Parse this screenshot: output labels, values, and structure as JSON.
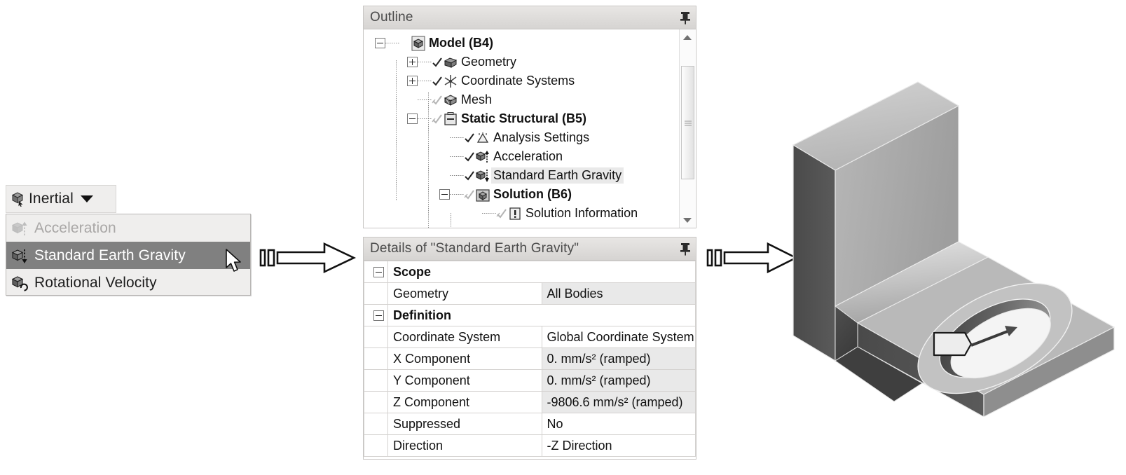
{
  "toolbar": {
    "inertial_button": {
      "label": "Inertial",
      "icon": "inertial-cube-icon",
      "caret": "chevron-down-icon"
    }
  },
  "inertial_menu": {
    "items": [
      {
        "label": "Acceleration",
        "icon": "cube-up-arrow-icon",
        "state": "disabled"
      },
      {
        "label": "Standard Earth Gravity",
        "icon": "cube-down-arrow-icon",
        "state": "selected"
      },
      {
        "label": "Rotational Velocity",
        "icon": "cube-rotation-icon",
        "state": "normal"
      }
    ]
  },
  "cursor": {
    "icon": "mouse-pointer-icon"
  },
  "flow": {
    "arrow_1": {
      "icon": "right-block-arrow-icon"
    },
    "arrow_2": {
      "icon": "right-block-arrow-icon"
    }
  },
  "outline_panel": {
    "title": "Outline",
    "pin_icon": "pin-icon",
    "scrollbar": {
      "up_icon": "scroll-up-arrow-icon",
      "down_icon": "scroll-down-arrow-icon",
      "grip_icon": "scroll-thumb-grip-icon"
    },
    "tree": [
      {
        "label": "Model (B4)",
        "indent": 0,
        "bold": true,
        "expander": "minus",
        "check": "none",
        "icon": "model-cube-icon",
        "highlight": false
      },
      {
        "label": "Geometry",
        "indent": 1,
        "bold": false,
        "expander": "plus",
        "check": "check",
        "icon": "geometry-icon",
        "highlight": false
      },
      {
        "label": "Coordinate Systems",
        "indent": 1,
        "bold": false,
        "expander": "plus",
        "check": "check",
        "icon": "coordinate-systems-icon",
        "highlight": false
      },
      {
        "label": "Mesh",
        "indent": 1,
        "bold": false,
        "expander": "none",
        "check": "partial",
        "icon": "mesh-icon",
        "highlight": false
      },
      {
        "label": "Static Structural (B5)",
        "indent": 1,
        "bold": true,
        "expander": "minus",
        "check": "partial",
        "icon": "static-structural-icon",
        "highlight": false
      },
      {
        "label": "Analysis Settings",
        "indent": 2,
        "bold": false,
        "expander": "none",
        "check": "check",
        "icon": "analysis-settings-icon",
        "highlight": false
      },
      {
        "label": "Acceleration",
        "indent": 2,
        "bold": false,
        "expander": "none",
        "check": "check",
        "icon": "cube-up-arrow-icon",
        "highlight": false
      },
      {
        "label": "Standard Earth Gravity",
        "indent": 2,
        "bold": false,
        "expander": "none",
        "check": "check",
        "icon": "cube-down-arrow-icon",
        "highlight": true
      },
      {
        "label": "Solution (B6)",
        "indent": 2,
        "bold": true,
        "expander": "minus",
        "check": "partial",
        "icon": "solution-icon",
        "highlight": false
      },
      {
        "label": "Solution Information",
        "indent": 3,
        "bold": false,
        "expander": "none",
        "check": "partial",
        "icon": "solution-information-icon",
        "highlight": false
      }
    ]
  },
  "details_panel": {
    "title": "Details of \"Standard Earth Gravity\"",
    "pin_icon": "pin-icon",
    "rows": [
      {
        "type": "group",
        "expander": "minus",
        "label": "Scope"
      },
      {
        "type": "property",
        "key": "Geometry",
        "value": "All Bodies",
        "value_shaded": true
      },
      {
        "type": "group",
        "expander": "minus",
        "label": "Definition"
      },
      {
        "type": "property",
        "key": "Coordinate System",
        "value": "Global Coordinate System",
        "value_shaded": false
      },
      {
        "type": "property",
        "key": "X Component",
        "value": "0. mm/s²  (ramped)",
        "value_shaded": true
      },
      {
        "type": "property",
        "key": "Y Component",
        "value": "0. mm/s²  (ramped)",
        "value_shaded": true
      },
      {
        "type": "property",
        "key": "Z Component",
        "value": "-9806.6 mm/s²  (ramped)",
        "value_shaded": true
      },
      {
        "type": "property",
        "key": "Suppressed",
        "value": "No",
        "value_shaded": false
      },
      {
        "type": "property",
        "key": "Direction",
        "value": "-Z Direction",
        "value_shaded": false
      }
    ]
  },
  "model_view": {
    "name": "bracket-3d-model",
    "annotation_icon": "gravity-direction-arrow-icon"
  },
  "colors": {
    "selection": "#808080",
    "panel_header": "#dedcda",
    "value_shaded": "#e9e9e9",
    "border": "#c8c6c4"
  }
}
